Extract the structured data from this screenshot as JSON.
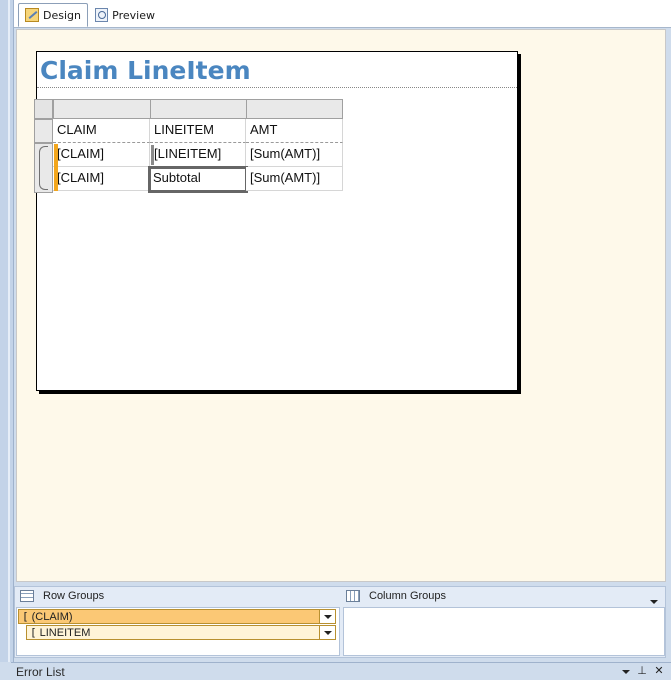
{
  "tabs": [
    {
      "label": "Design",
      "icon": "design-icon",
      "active": true
    },
    {
      "label": "Preview",
      "icon": "preview-icon",
      "active": false
    }
  ],
  "report": {
    "title": "Claim  LineItem",
    "title_color": "#4a86c0"
  },
  "tablix": {
    "header": [
      "CLAIM",
      "LINEITEM",
      "AMT"
    ],
    "rows": [
      [
        "[CLAIM]",
        "[LINEITEM]",
        "[Sum(AMT)]"
      ],
      [
        "[CLAIM]",
        "Subtotal",
        "[Sum(AMT)]"
      ]
    ],
    "group_indicator_color": "#f3a61c"
  },
  "groups": {
    "row_label": "Row Groups",
    "column_label": "Column Groups",
    "row_groups": [
      {
        "label": "(CLAIM)",
        "selected": true
      },
      {
        "label": "LINEITEM",
        "selected": false
      }
    ]
  },
  "error_list": {
    "title": "Error List"
  }
}
